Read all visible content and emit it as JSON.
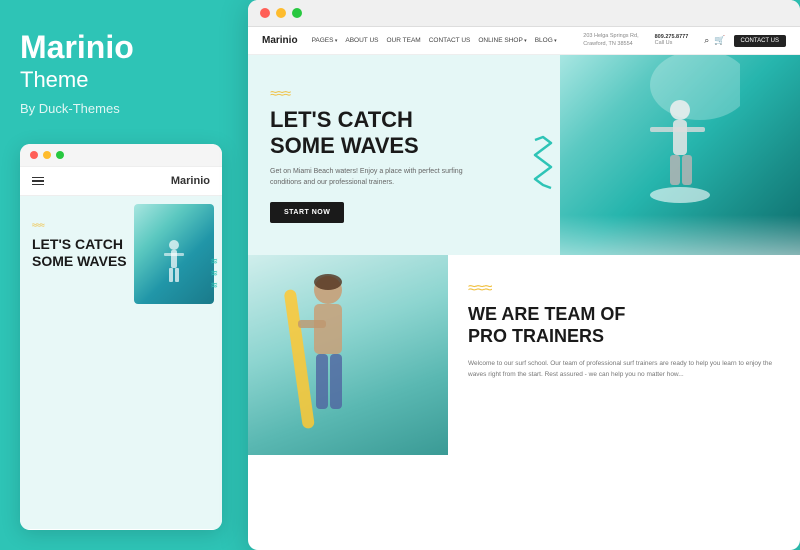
{
  "left": {
    "title": "Marinio",
    "subtitle": "Theme",
    "author": "By Duck-Themes",
    "mini_browser": {
      "dots": [
        "red",
        "yellow",
        "green"
      ],
      "nav_logo": "Marinio",
      "headline_line1": "LET'S CATCH",
      "zigzag_color": "#f0c040"
    }
  },
  "right": {
    "browser_dots": [
      "red",
      "yellow",
      "green"
    ],
    "nav": {
      "logo": "Marinio",
      "links": [
        "PAGES",
        "ABOUT US",
        "OUR TEAM",
        "CONTACT US",
        "ONLINE SHOP",
        "BLOG"
      ],
      "address_line1": "203 Helga Springs Rd,",
      "address_line2": "Crawford, TN 38554",
      "phone": "809.275.8777",
      "phone_label": "Call Us",
      "contact_btn": "CONTACT US"
    },
    "hero": {
      "zigzag": "≈≈≈",
      "title_line1": "LET'S CATCH",
      "title_line2": "SOME WAVES",
      "description": "Get on Miami Beach waters! Enjoy a place with perfect surfing\nconditions and our professional trainers.",
      "cta_button": "START NOW"
    },
    "second": {
      "zigzag": "≈≈≈",
      "title_line1": "WE ARE TEAM OF",
      "title_line2": "PRO TRAINERS",
      "description": "Welcome to our surf school. Our team of professional surf\ntrainers are ready to help you learn to enjoy the waves right\nfrom the start. Rest assured - we can help you no matter how..."
    }
  }
}
